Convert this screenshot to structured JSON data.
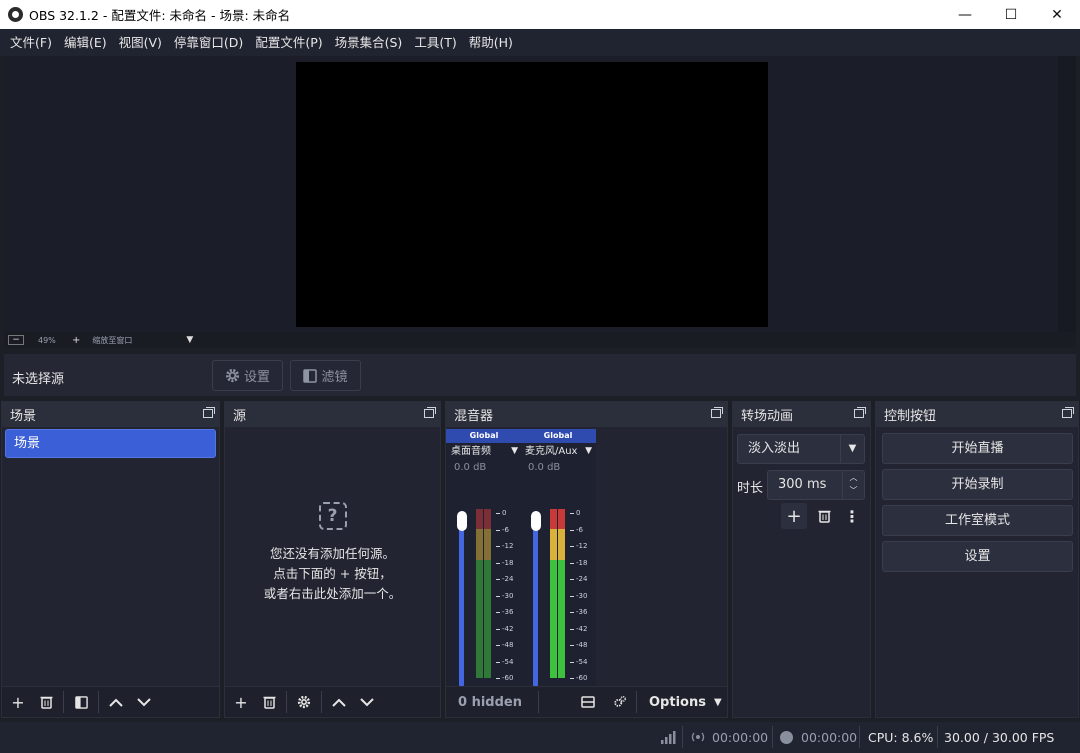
{
  "window": {
    "title": "OBS 32.1.2 - 配置文件: 未命名 - 场景: 未命名",
    "minimize": "—",
    "maximize": "☐",
    "close": "✕"
  },
  "menu": [
    "文件(F)",
    "编辑(E)",
    "视图(V)",
    "停靠窗口(D)",
    "配置文件(P)",
    "场景集合(S)",
    "工具(T)",
    "帮助(H)"
  ],
  "zoom": {
    "minus": "−",
    "value": "49%",
    "plus": "+",
    "fit_label": "缩放至窗口",
    "caret": "▼"
  },
  "source_toolbar": {
    "no_source": "未选择源",
    "properties_label": "设置",
    "filters_label": "滤镜"
  },
  "docks": {
    "scenes": {
      "title": "场景",
      "items": [
        "场景"
      ]
    },
    "sources": {
      "title": "源",
      "empty_icon": "?",
      "empty_lines": [
        "您还没有添加任何源。",
        "点击下面的 + 按钮，",
        "或者右击此处添加一个。"
      ]
    },
    "mixer": {
      "title": "混音器",
      "channels": [
        {
          "tag": "Global",
          "name": "桌面音频",
          "db": "0.0 dB",
          "level": 1.0
        },
        {
          "tag": "Global",
          "name": "麦克风/Aux",
          "db": "0.0 dB",
          "level": 1.0
        }
      ],
      "scale": [
        "0",
        "-6",
        "-12",
        "-18",
        "-24",
        "-30",
        "-36",
        "-42",
        "-48",
        "-54",
        "-60"
      ],
      "hidden_label": "0 hidden",
      "options_label": "Options"
    },
    "transitions": {
      "title": "转场动画",
      "selected": "淡入淡出",
      "duration_label": "时长",
      "duration_value": "300 ms"
    },
    "controls": {
      "title": "控制按钮",
      "buttons": [
        "开始直播",
        "开始录制",
        "工作室模式",
        "设置"
      ]
    }
  },
  "status": {
    "stream_time": "00:00:00",
    "record_time": "00:00:00",
    "cpu": "CPU: 8.6%",
    "fps": "30.00 / 30.00 FPS"
  },
  "colors": {
    "accent": "#3b5fd6",
    "meter_green": "#3ec13e",
    "meter_yellow": "#d8b23a",
    "meter_red": "#c83a3a"
  }
}
